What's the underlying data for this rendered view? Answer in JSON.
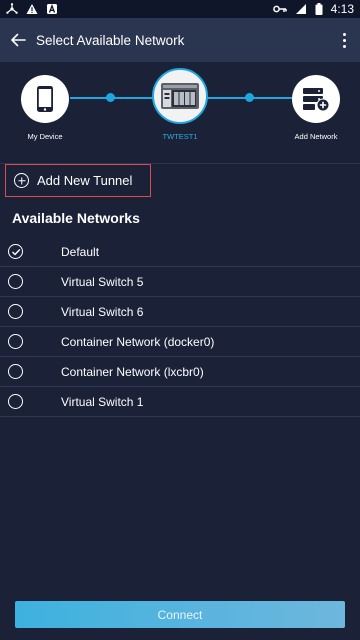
{
  "status_bar": {
    "time": "4:13",
    "icons": [
      "network-share-icon",
      "warning-icon",
      "a-badge-icon",
      "vpn-key-icon",
      "signal-icon",
      "battery-icon"
    ]
  },
  "app_bar": {
    "title": "Select Available Network",
    "back_icon": "arrow-left-icon",
    "menu_icon": "more-vertical-icon"
  },
  "stepper": {
    "nodes": [
      {
        "label": "My Device",
        "icon": "smartphone-icon",
        "active": false
      },
      {
        "label": "TWTEST1",
        "icon": "nas-device-icon",
        "active": true
      },
      {
        "label": "Add Network",
        "icon": "server-add-icon",
        "active": false
      }
    ],
    "accent": "#1ea7e0"
  },
  "add_tunnel": {
    "label": "Add New Tunnel",
    "icon": "plus-circle-icon"
  },
  "available_networks": {
    "title": "Available Networks",
    "items": [
      {
        "label": "Default",
        "checked": true
      },
      {
        "label": "Virtual Switch 5",
        "checked": false
      },
      {
        "label": "Virtual Switch 6",
        "checked": false
      },
      {
        "label": "Container Network (docker0)",
        "checked": false
      },
      {
        "label": "Container Network (lxcbr0)",
        "checked": false
      },
      {
        "label": "Virtual Switch 1",
        "checked": false
      }
    ]
  },
  "connect_button": {
    "label": "Connect"
  },
  "colors": {
    "background": "#1b2238",
    "appbar": "#2a3550",
    "accent": "#1ea7e0",
    "highlight_border": "#d84b4f"
  }
}
